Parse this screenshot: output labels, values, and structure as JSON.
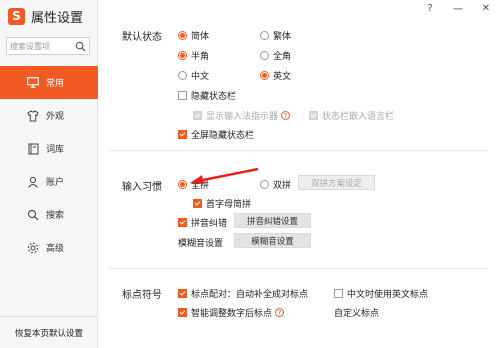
{
  "app": {
    "title": "属性设置"
  },
  "window": {
    "help": "?",
    "minimize": "一",
    "close": "✕"
  },
  "search": {
    "placeholder": "搜索设置项"
  },
  "sidebar": {
    "items": [
      {
        "label": "常用",
        "icon": "monitor-icon",
        "active": true
      },
      {
        "label": "外观",
        "icon": "shirt-icon"
      },
      {
        "label": "词库",
        "icon": "book-icon"
      },
      {
        "label": "账户",
        "icon": "user-icon"
      },
      {
        "label": "搜索",
        "icon": "search-icon"
      },
      {
        "label": "高级",
        "icon": "gear-icon"
      }
    ],
    "restore": "恢复本页默认设置"
  },
  "default_state": {
    "label": "默认状态",
    "simplified": "简体",
    "traditional": "繁体",
    "halfwidth": "半角",
    "fullwidth": "全角",
    "chinese": "中文",
    "english": "英文",
    "hide_statusbar": "隐藏状态栏",
    "show_indicator": "显示输入法指示器",
    "embed_language_bar": "状态栏嵌入语言栏",
    "fullscreen_hide": "全屏隐藏状态栏"
  },
  "input_habit": {
    "label": "输入习惯",
    "quanpin": "全拼",
    "shuangpin": "双拼",
    "shuangpin_btn": "双拼方案设定",
    "initials": "首字母简拼",
    "correction": "拼音纠错",
    "correction_btn": "拼音纠错设置",
    "fuzzy_label": "模糊音设置",
    "fuzzy_btn": "模糊音设置"
  },
  "punctuation": {
    "label": "标点符号",
    "auto_pair": "标点配对：自动补全成对标点",
    "english_punct": "中文时使用英文标点",
    "smart_number": "智能调整数字后标点",
    "custom": "自定义标点"
  },
  "colors": {
    "accent": "#f25a23"
  }
}
